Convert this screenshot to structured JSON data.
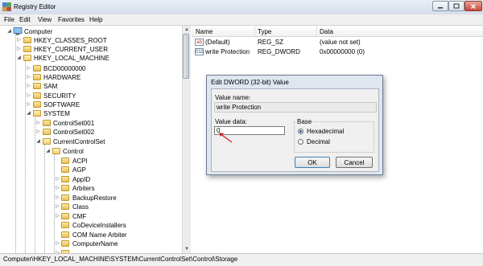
{
  "window": {
    "title": "Registry Editor",
    "icon": "registry-editor-icon"
  },
  "menu": [
    "File",
    "Edit",
    "View",
    "Favorites",
    "Help"
  ],
  "tree": {
    "root": "Computer",
    "hives": [
      "HKEY_CLASSES_ROOT",
      "HKEY_CURRENT_USER",
      "HKEY_LOCAL_MACHINE"
    ],
    "hklm_keys": [
      "BCD00000000",
      "HARDWARE",
      "SAM",
      "SECURITY",
      "SOFTWARE",
      "SYSTEM"
    ],
    "system_keys": [
      "ControlSet001",
      "ControlSet002",
      "CurrentControlSet"
    ],
    "ccs_keys": [
      "Control"
    ],
    "control_keys": [
      "ACPI",
      "AGP",
      "AppID",
      "Arbiters",
      "BackupRestore",
      "Class",
      "CMF",
      "CoDeviceInstallers",
      "COM Name Arbiter",
      "ComputerName"
    ]
  },
  "list": {
    "columns": [
      "Name",
      "Type",
      "Data"
    ],
    "rows": [
      {
        "name": "(Default)",
        "type": "REG_SZ",
        "data": "(value not set)",
        "icon": "ab"
      },
      {
        "name": "write Protection",
        "type": "REG_DWORD",
        "data": "0x00000000 (0)",
        "icon": "011"
      }
    ]
  },
  "dialog": {
    "title": "Edit DWORD (32-bit) Value",
    "value_name_label": "Value name:",
    "value_name": "write Protection",
    "value_data_label": "Value data:",
    "value_data": "0",
    "base_label": "Base",
    "base_options": [
      "Hexadecimal",
      "Decimal"
    ],
    "base_selected": "Hexadecimal",
    "ok": "OK",
    "cancel": "Cancel"
  },
  "status": "Computer\\HKEY_LOCAL_MACHINE\\SYSTEM\\CurrentControlSet\\Control\\Storage",
  "colors": {
    "arrow": "#d02020",
    "titlebar": "#dbe3ee"
  }
}
